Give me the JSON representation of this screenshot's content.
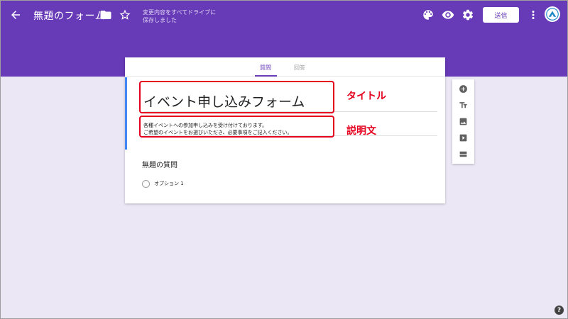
{
  "header": {
    "form_title": "無題のフォーム",
    "save_status": "変更内容をすべてドライブに保存しました",
    "send_label": "送信"
  },
  "tabs": [
    {
      "label": "質問",
      "active": true
    },
    {
      "label": "回答",
      "active": false
    }
  ],
  "form": {
    "title": "イベント申し込みフォーム",
    "description_line1": "各種イベントへの参加申し込みを受け付けております。",
    "description_line2": "ご希望のイベントをお選びいただき、必要事項をご記入ください。"
  },
  "question": {
    "title": "無題の質問",
    "option_label": "オプション 1"
  },
  "annotations": {
    "title_label": "タイトル",
    "description_label": "説明文"
  },
  "side_tools": [
    "add-question-icon",
    "add-title-icon",
    "add-image-icon",
    "add-video-icon",
    "add-section-icon"
  ],
  "colors": {
    "theme": "#673ab7",
    "background": "#ebe7f5",
    "annotation": "#e5001e",
    "focus_bar": "#4285f4"
  }
}
